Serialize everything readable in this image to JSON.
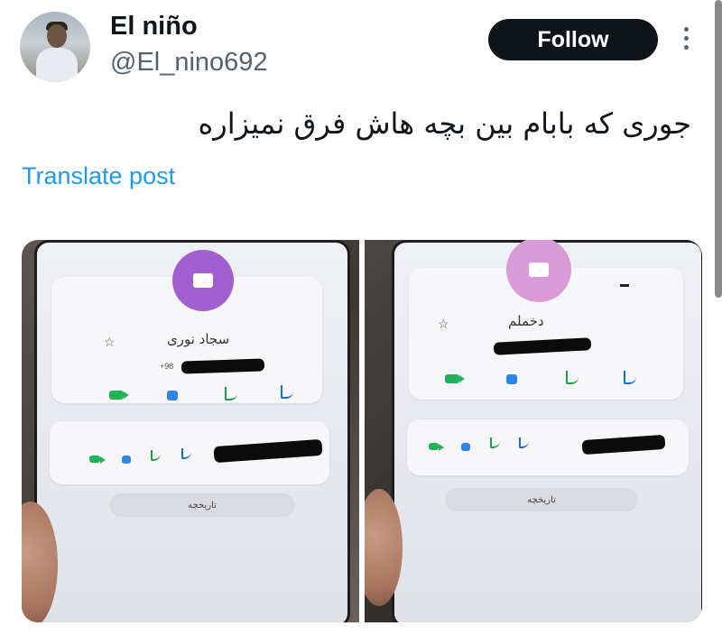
{
  "tweet": {
    "display_name": "El niño",
    "handle": "@El_nino692",
    "follow_label": "Follow",
    "text": "جوری که بابام بین بچه هاش فرق نمیزاره",
    "translate_label": "Translate post"
  },
  "images": [
    {
      "contact_name": "سجاد نوری",
      "phone_prefix": "+98",
      "history_label": "تاریخچه",
      "avatar_color": "#a25fd0"
    },
    {
      "contact_name": "دخملم",
      "history_label": "تاریخچه",
      "avatar_color": "#d99ad8"
    }
  ],
  "icons": {
    "more": "more-vertical-icon",
    "camera": "camera-icon",
    "star": "star-icon",
    "video": "video-call-icon",
    "message": "message-icon",
    "call": "phone-call-icon"
  }
}
